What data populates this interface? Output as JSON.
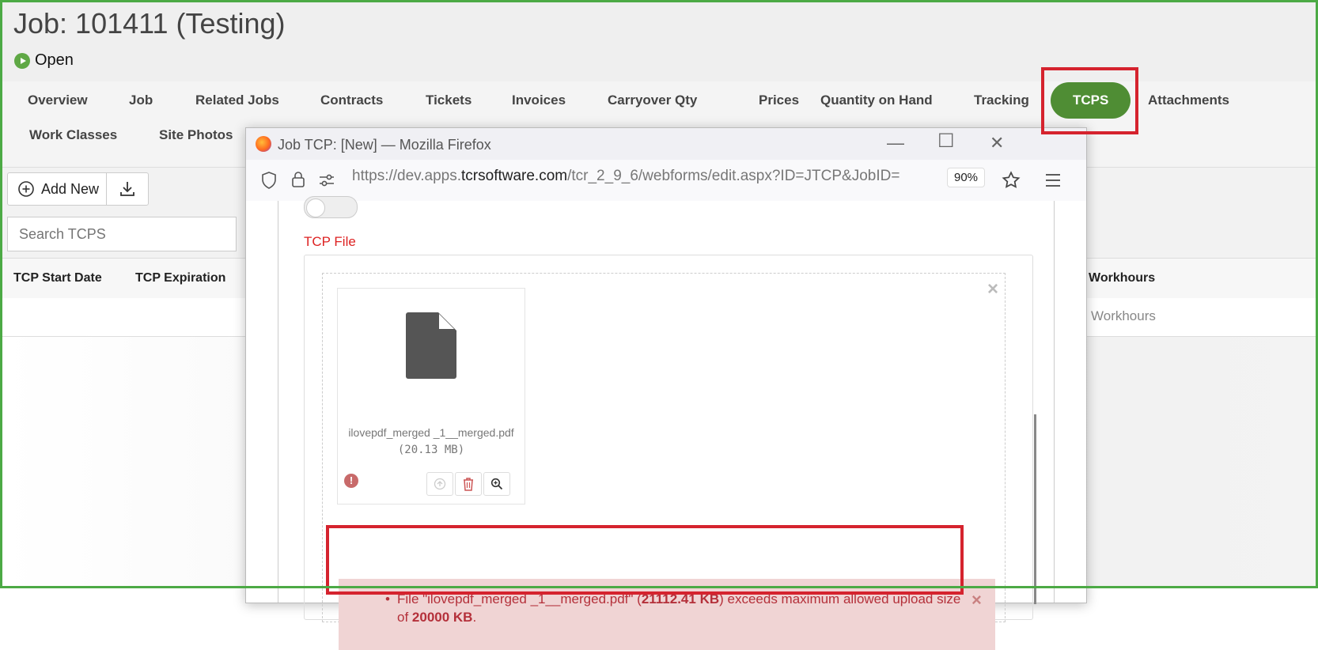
{
  "page": {
    "title": "Job: 101411 (Testing)",
    "status": "Open"
  },
  "tabs": [
    {
      "label": "Overview"
    },
    {
      "label": "Job"
    },
    {
      "label": "Related Jobs"
    },
    {
      "label": "Contracts"
    },
    {
      "label": "Tickets"
    },
    {
      "label": "Invoices"
    },
    {
      "label": "Carryover Qty"
    },
    {
      "label": "Prices"
    },
    {
      "label": "Quantity on Hand"
    },
    {
      "label": "Tracking"
    },
    {
      "label": "TCPS",
      "active": true
    },
    {
      "label": "Attachments"
    },
    {
      "label": "Work Classes"
    },
    {
      "label": "Site Photos"
    }
  ],
  "toolbar": {
    "add_new_label": "Add New",
    "download_icon": "download-icon"
  },
  "search": {
    "placeholder": "Search TCPS"
  },
  "table": {
    "columns": [
      "TCP Start Date",
      "TCP Expiration",
      "Workhours"
    ],
    "row": {
      "workhours": "Workhours"
    }
  },
  "popup": {
    "window_title": "Job TCP: [New] — Mozilla Firefox",
    "url_prefix": "https://dev.apps.",
    "url_domain": "tcrsoftware.com",
    "url_path": "/tcr_2_9_6/webforms/edit.aspx?ID=JTCP&JobID=",
    "zoom": "90%",
    "section_label": "TCP File",
    "file": {
      "name": "ilovepdf_merged _1__merged.pdf",
      "size": "(20.13 MB)"
    },
    "error": {
      "prefix": "File \"ilovepdf_merged _1__merged.pdf\" (",
      "size_bold": "21112.41 KB",
      "middle": ") exceeds maximum allowed upload size of ",
      "limit_bold": "20000 KB",
      "suffix": "."
    }
  },
  "colors": {
    "accent_green": "#4f8d34",
    "highlight_red": "#d5232e",
    "frame_green": "#4caa45",
    "error_text": "#b4303a",
    "error_bg": "#f0d4d4"
  }
}
